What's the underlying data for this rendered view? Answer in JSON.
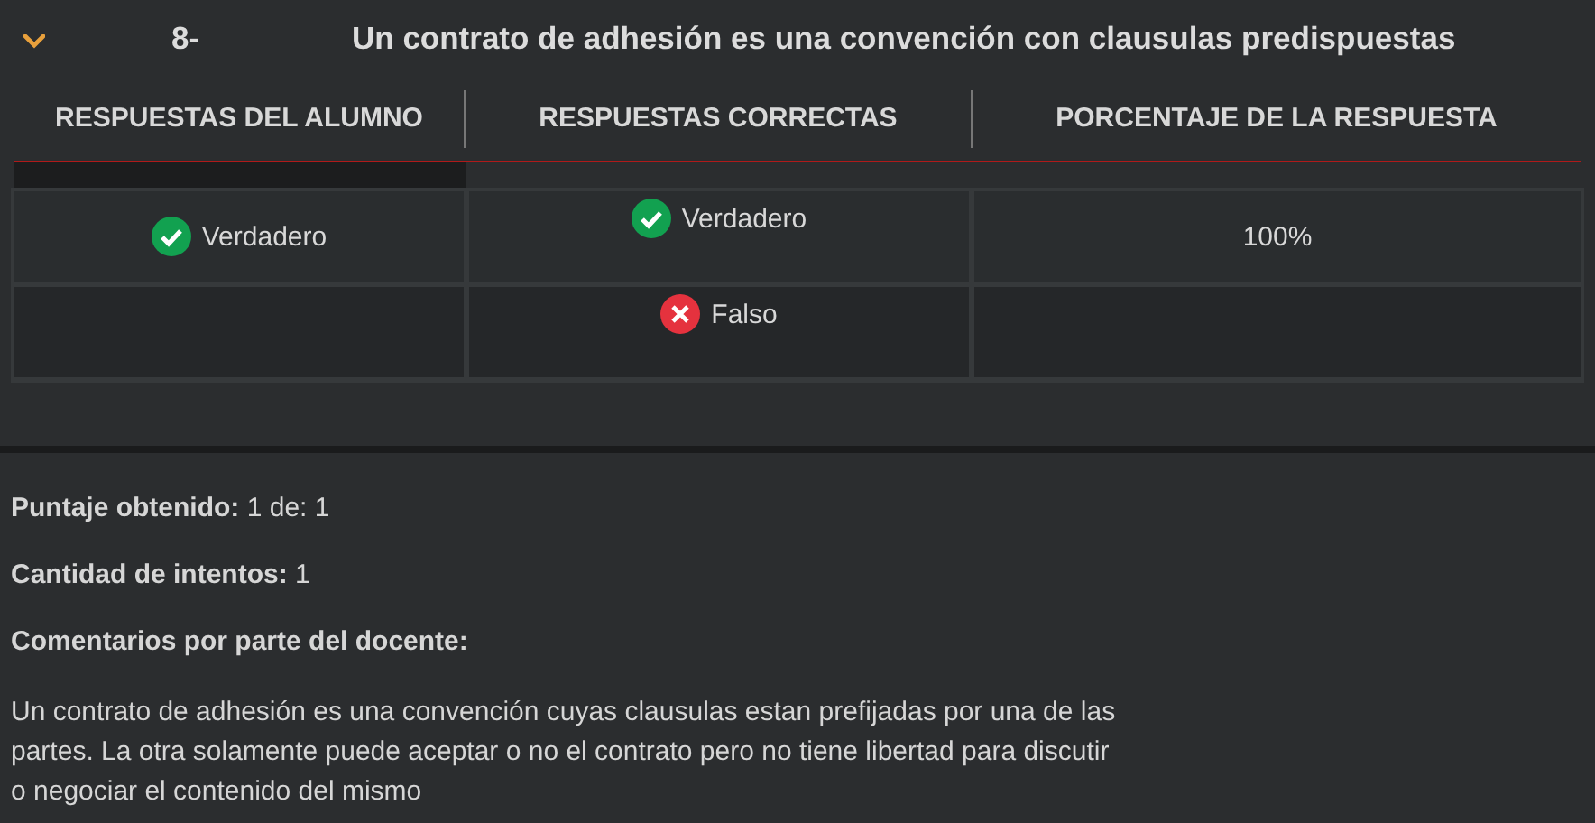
{
  "question": {
    "expanded": true,
    "number": "8-",
    "title": "Un contrato de adhesión es una convención con clausulas predispuestas"
  },
  "table": {
    "columns": [
      "RESPUESTAS DEL ALUMNO",
      "RESPUESTAS CORRECTAS",
      "PORCENTAJE DE LA RESPUESTA"
    ],
    "rows": [
      {
        "student": [
          {
            "kind": "correct",
            "label": "Verdadero"
          }
        ],
        "correct": [
          {
            "kind": "correct",
            "label": "Verdadero"
          }
        ],
        "percent": "100%"
      },
      {
        "student": [],
        "correct": [
          {
            "kind": "incorrect",
            "label": "Falso"
          }
        ]
      }
    ]
  },
  "summary": [
    "**Puntaje obtenido:** 1 de: 1",
    "**Cantidad de intentos:** 1",
    "**Comentarios por parte del docente:**"
  ],
  "comment": "Un contrato de adhesión es una convención cuyas clausulas estan prefijadas por una de las partes. La otra solamente puede aceptar o no el contrato pero no tiene libertad para discutir o negociar el contenido del mismo"
}
